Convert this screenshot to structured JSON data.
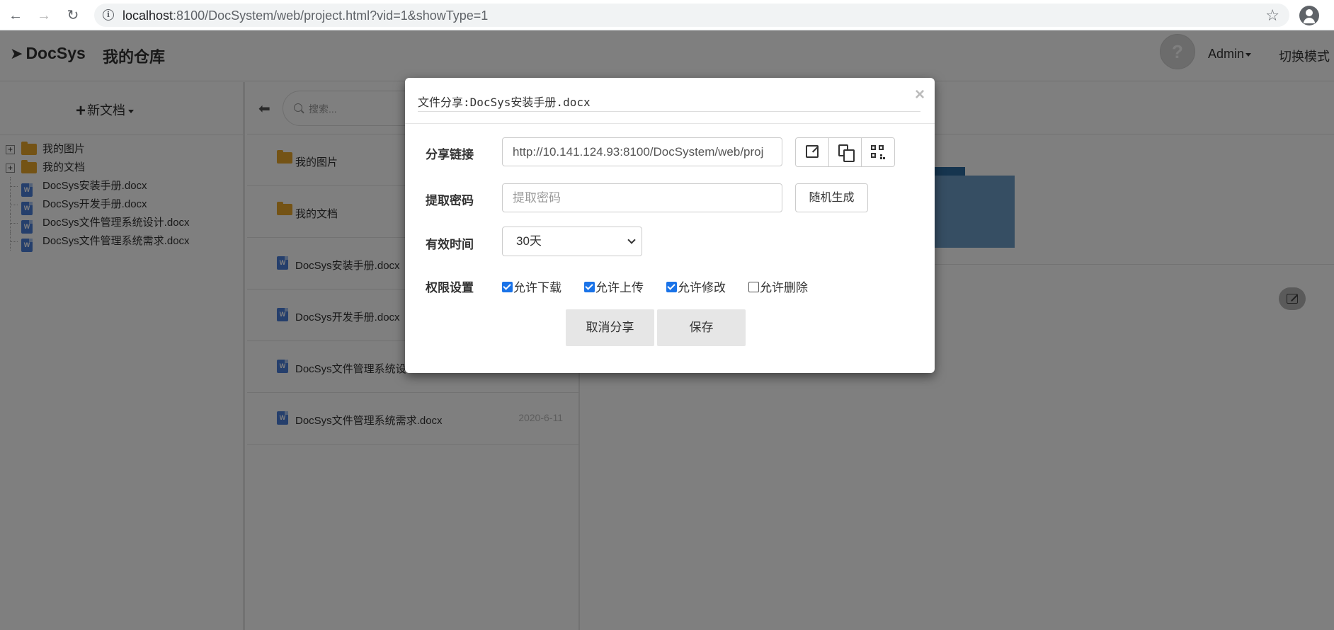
{
  "browser": {
    "url_host": "localhost",
    "url_rest": ":8100/DocSystem/web/project.html?vid=1&showType=1"
  },
  "header": {
    "brand": "DocSys",
    "repo_name": "我的仓库",
    "user_menu": "Admin",
    "switch_mode": "切换模式"
  },
  "sidebar": {
    "new_doc_label": "新文档",
    "tree": [
      {
        "label": "我的图片",
        "type": "folder"
      },
      {
        "label": "我的文档",
        "type": "folder"
      },
      {
        "label": "DocSys安装手册.docx",
        "type": "word"
      },
      {
        "label": "DocSys开发手册.docx",
        "type": "word"
      },
      {
        "label": "DocSys文件管理系统设计.docx",
        "type": "word"
      },
      {
        "label": "DocSys文件管理系统需求.docx",
        "type": "word"
      }
    ]
  },
  "list": {
    "search_placeholder": "搜索...",
    "rows": [
      {
        "name": "我的图片",
        "type": "folder",
        "date": ""
      },
      {
        "name": "我的文档",
        "type": "folder",
        "date": ""
      },
      {
        "name": "DocSys安装手册.docx",
        "type": "word",
        "date": ""
      },
      {
        "name": "DocSys开发手册.docx",
        "type": "word",
        "date": ""
      },
      {
        "name": "DocSys文件管理系统设",
        "type": "word",
        "date": ""
      },
      {
        "name": "DocSys文件管理系统需求.docx",
        "type": "word",
        "date": "2020-6-11"
      }
    ]
  },
  "modal": {
    "title": "文件分享:DocSys安装手册.docx",
    "close_label": "×",
    "share_link_label": "分享链接",
    "share_link_value": "http://10.141.124.93:8100/DocSystem/web/proj",
    "password_label": "提取密码",
    "password_placeholder": "提取密码",
    "random_button": "随机生成",
    "expiry_label": "有效时间",
    "expiry_value": "30天",
    "permission_label": "权限设置",
    "permissions": [
      {
        "label": "允许下载",
        "checked": true
      },
      {
        "label": "允许上传",
        "checked": true
      },
      {
        "label": "允许修改",
        "checked": true
      },
      {
        "label": "允许删除",
        "checked": false
      }
    ],
    "cancel_share_button": "取消分享",
    "save_button": "保存"
  }
}
